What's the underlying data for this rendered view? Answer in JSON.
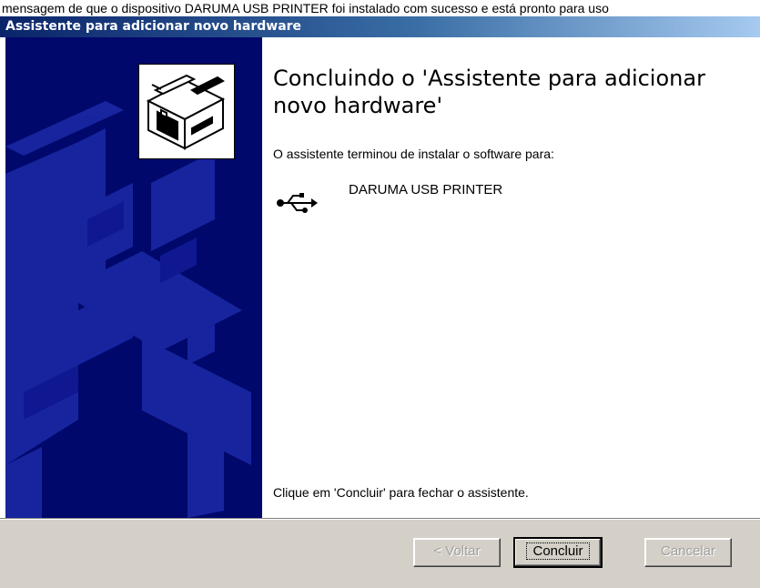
{
  "page": {
    "top_fragment": "mensagem de que o dispositivo DARUMA USB PRINTER foi instalado com sucesso e está pronto para uso"
  },
  "window": {
    "title": "Assistente para adicionar novo hardware"
  },
  "content": {
    "heading": "Concluindo o 'Assistente para adicionar novo hardware'",
    "intro": "O assistente terminou de instalar o software para:",
    "device_icon": "usb-icon",
    "device_name": "DARUMA USB PRINTER",
    "footer": "Clique em 'Concluir' para fechar o assistente."
  },
  "buttons": {
    "back": "< Voltar",
    "finish": "Concluir",
    "cancel": "Cancelar"
  },
  "colors": {
    "banner": "#00086b",
    "titlebar_start": "#0a246a",
    "button_face": "#d4d0c8"
  }
}
